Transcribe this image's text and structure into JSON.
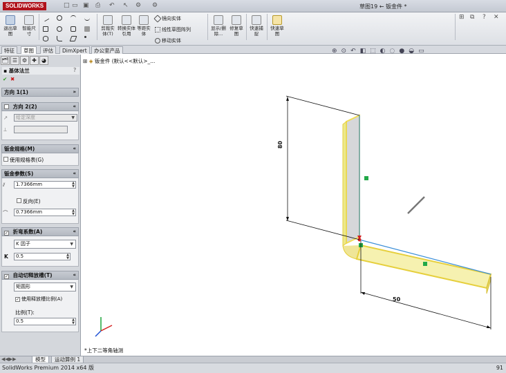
{
  "app": {
    "logo": "SOLIDWORKS",
    "document_title": "草图19 ← 钣金件 *"
  },
  "ribbon": {
    "big_buttons": [
      {
        "id": "exit-sketch",
        "label": "退出草图"
      },
      {
        "id": "smart-dim",
        "label": "智能尺寸"
      },
      {
        "id": "trim",
        "label": "剪裁实体(T)"
      },
      {
        "id": "convert",
        "label": "转换实体引用"
      },
      {
        "id": "offset",
        "label": "等距实体"
      },
      {
        "id": "display-delete",
        "label": "显示/删除..."
      },
      {
        "id": "repair",
        "label": "修复草图"
      },
      {
        "id": "rapid-snap",
        "label": "快速捕捉"
      },
      {
        "id": "quick-sketch",
        "label": "快速草图"
      }
    ],
    "small_buttons": [
      {
        "id": "mirror",
        "label": "镜向实体"
      },
      {
        "id": "linear-pattern",
        "label": "线性草图阵列"
      },
      {
        "id": "move",
        "label": "移动实体"
      }
    ]
  },
  "tabs": [
    "特征",
    "草图",
    "评估",
    "DimXpert",
    "办公室产品"
  ],
  "feature_tree": {
    "root": "钣金件 (默认<<默认>_..."
  },
  "property_manager": {
    "title": "基体法兰",
    "ok": "✔",
    "cancel": "✖",
    "direction1": "方向 1(1)",
    "direction2": "方向 2(2)",
    "dir2_type": "给定深度",
    "gauge_section": "钣金规格(M)",
    "use_gauge": "使用规格表(G)",
    "params_section": "钣金参数(S)",
    "thickness": "1.7366mm",
    "reverse": "反向(E)",
    "radius": "0.7366mm",
    "bend_section": "折弯系数(A)",
    "bend_type": "K 因子",
    "k_label": "K",
    "k_value": "0.5",
    "relief_section": "自动切释放槽(T)",
    "relief_type": "矩圆形",
    "relief_option": "使用释放槽比例(A)",
    "ratio_label": "比例(T):",
    "ratio_value": "0.5"
  },
  "viewport": {
    "view_name": "*上下二等角轴测",
    "dim_vertical": "80",
    "dim_horizontal": "50"
  },
  "bottom_tabs": [
    "模型",
    "运动算例 1"
  ],
  "status": {
    "text": "SolidWorks Premium 2014 x64 版",
    "right": "91"
  }
}
